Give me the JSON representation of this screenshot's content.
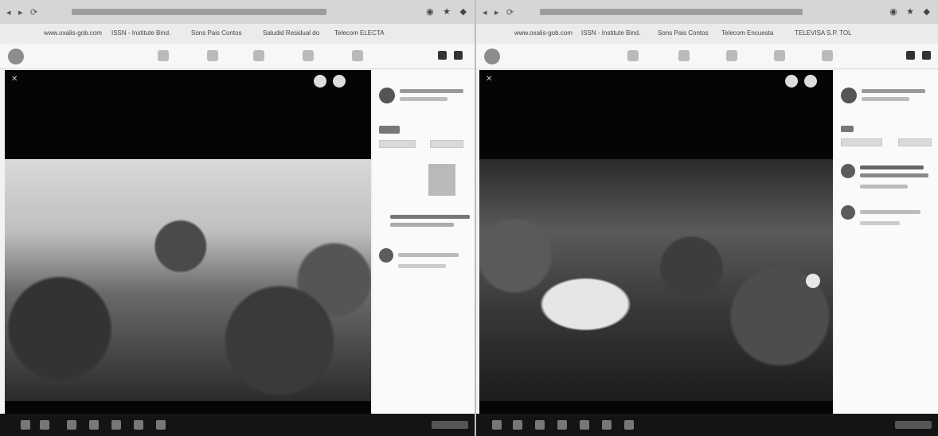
{
  "panes": [
    {
      "id": "left",
      "bookmarks": [
        "www.oxalis-gob.com",
        "ISSN - Institute Bind.",
        "Sons Pais Contos",
        "Saludid Residual do",
        "Telecom ELECTA"
      ]
    },
    {
      "id": "right",
      "bookmarks": [
        "www.oxalis-gob.com",
        "ISSN - Institute Bind.",
        "Sons Pais Contos",
        "Telecom Encuesta",
        "TELEVISA S.P. TOL"
      ]
    }
  ],
  "icons": {
    "browser": [
      "back-icon",
      "forward-icon",
      "reload-icon",
      "star-icon",
      "extensions-icon"
    ],
    "facebook_nav": [
      "home-icon",
      "watch-icon",
      "marketplace-icon",
      "groups-icon",
      "gaming-icon"
    ],
    "viewer": [
      "close-icon",
      "zoom-icon",
      "fullscreen-icon",
      "next-arrow-icon"
    ]
  },
  "colors": {
    "viewer_bg": "#050505",
    "sidebar_bg": "#fafafa",
    "taskbar_bg": "#141414"
  }
}
